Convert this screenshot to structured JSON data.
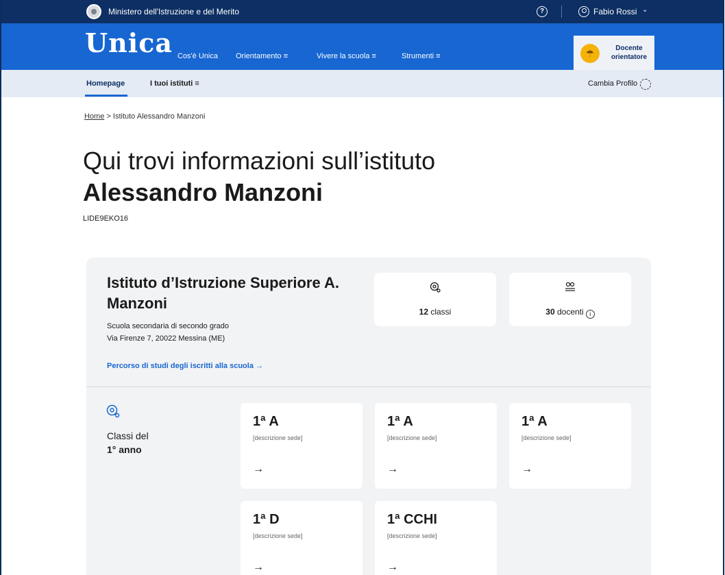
{
  "ministry_bar": {
    "name": "Ministero dell'Istruzione e del Merito",
    "help_symbol": "?",
    "user_name": "Fabio Rossi",
    "user_chevron": "⌄"
  },
  "main_nav": {
    "logo": "Unica",
    "links": [
      "Cos'è Unica",
      "Orientamento ≡",
      "Vivere la scuola ≡",
      "Strumenti ≡"
    ],
    "role_icon": "☂",
    "role_label": "Docente orientatore"
  },
  "sub_nav": {
    "home": "Homepage",
    "istituti": "I tuoi istituti ≡",
    "cambia_profilo": "Cambia Profilo"
  },
  "breadcrumb": {
    "home": "Home",
    "separator": " > ",
    "current": "Istituto Alessandro Manzoni"
  },
  "page": {
    "title_line1": "Qui trovi informazioni sull’istituto",
    "title_line2": "Alessandro Manzoni",
    "code": "LIDE9EKO16"
  },
  "school": {
    "name": "Istituto d’Istruzione Superiore A. Manzoni",
    "type": "Scuola secondaria di secondo grado",
    "address": "Via Firenze 7, 20022 Messina (ME)",
    "percorso_link": "Percorso di studi degli iscritti alla scuola  →"
  },
  "stats": {
    "classi_num": "12",
    "classi_label": " classi",
    "docenti_num": "30",
    "docenti_label": " docenti",
    "info_symbol": "i"
  },
  "classi_section": {
    "label": "Classi del",
    "label_strong": "1° anno"
  },
  "class_cards": [
    {
      "name": "1ª A",
      "desc": "[descrizione sede]",
      "arrow": "→"
    },
    {
      "name": "1ª A",
      "desc": "[descrizione sede]",
      "arrow": "→"
    },
    {
      "name": "1ª A",
      "desc": "[descrizione sede]",
      "arrow": "→"
    },
    {
      "name": "1ª D",
      "desc": "[descrizione sede]",
      "arrow": "→"
    },
    {
      "name": "1ª CCHI",
      "desc": "[descrizione sede]",
      "arrow": "→"
    }
  ],
  "colors": {
    "ministry_bar": "#0d2f63",
    "main_nav": "#1766d2",
    "sub_nav": "#e4ebf5",
    "panel": "#f2f3f5",
    "role_avatar": "#f5b30a"
  }
}
